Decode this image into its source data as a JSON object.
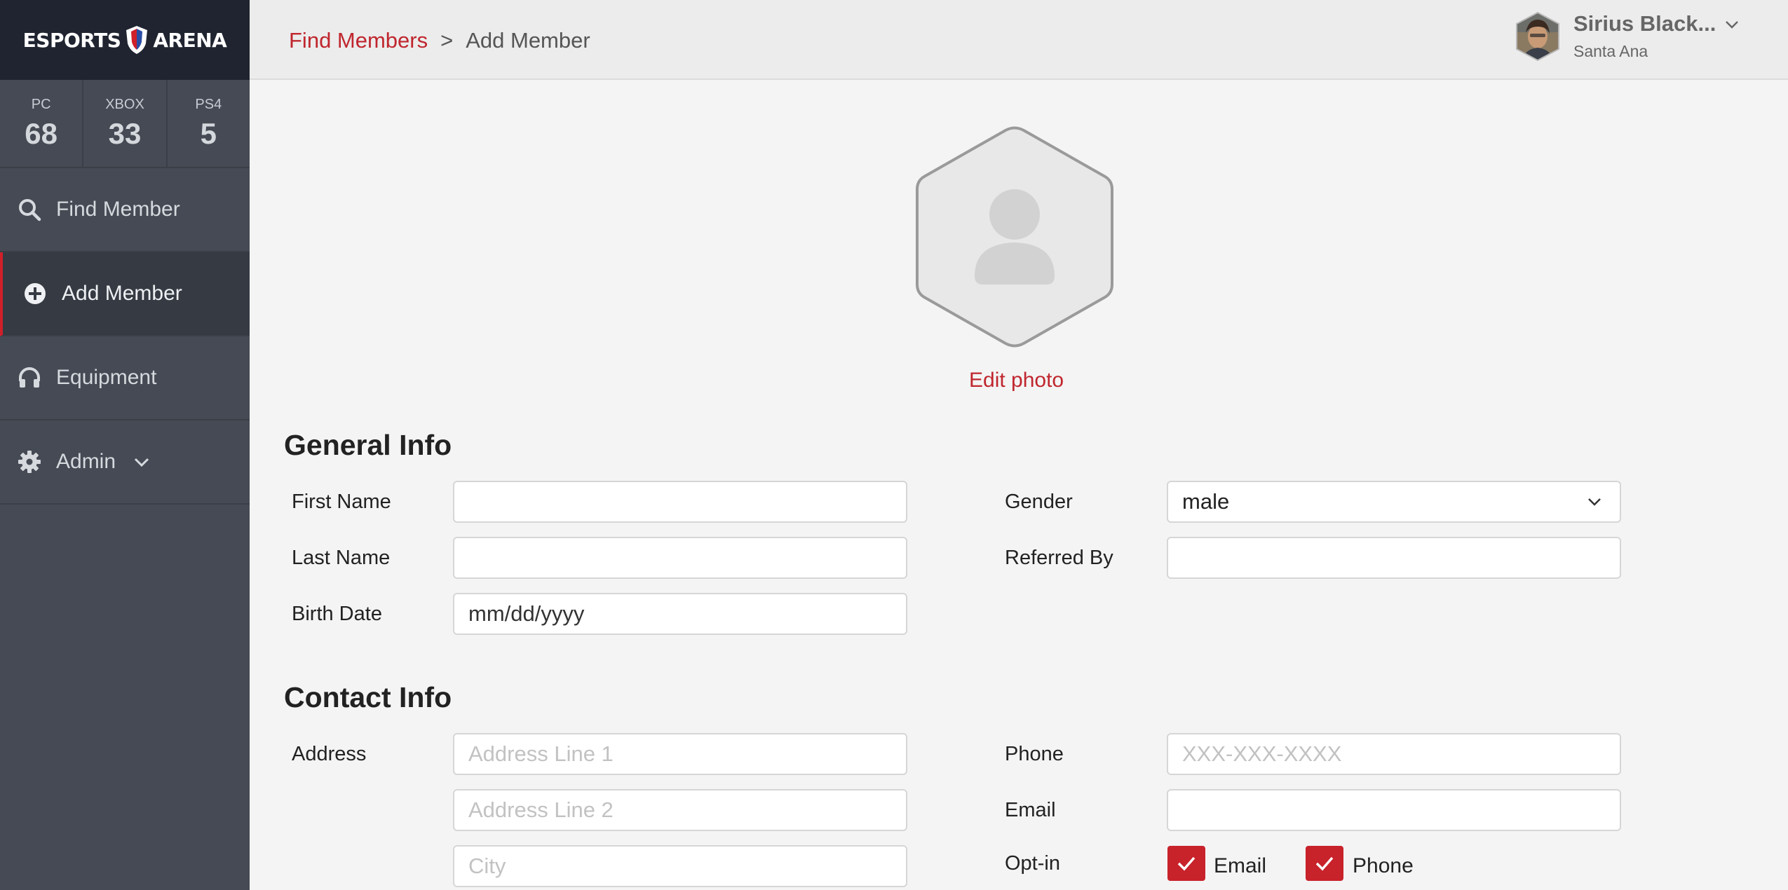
{
  "app": {
    "logo_left": "ESPORTS",
    "logo_right": "ARENA"
  },
  "stats": [
    {
      "label": "PC",
      "value": "68"
    },
    {
      "label": "XBOX",
      "value": "33"
    },
    {
      "label": "PS4",
      "value": "5"
    }
  ],
  "nav": {
    "find_member": "Find Member",
    "add_member": "Add Member",
    "equipment": "Equipment",
    "admin": "Admin"
  },
  "breadcrumb": {
    "link": "Find Members",
    "separator": ">",
    "current": "Add Member"
  },
  "user": {
    "name": "Sirius Black...",
    "location": "Santa Ana"
  },
  "photo": {
    "edit_label": "Edit photo"
  },
  "general": {
    "title": "General Info",
    "first_name_label": "First Name",
    "first_name_value": "",
    "last_name_label": "Last Name",
    "last_name_value": "",
    "birth_date_label": "Birth Date",
    "birth_date_value": "mm/dd/yyyy",
    "gender_label": "Gender",
    "gender_value": "male",
    "referred_by_label": "Referred By",
    "referred_by_value": ""
  },
  "contact": {
    "title": "Contact Info",
    "address_label": "Address",
    "address1_placeholder": "Address Line 1",
    "address2_placeholder": "Address Line 2",
    "city_placeholder": "City",
    "phone_label": "Phone",
    "phone_placeholder": "XXX-XXX-XXXX",
    "email_label": "Email",
    "email_value": "",
    "optin_label": "Opt-in",
    "optin_email": "Email",
    "optin_phone": "Phone"
  },
  "colors": {
    "accent": "#c0262e",
    "sidebar": "#454a54",
    "logo_bar": "#1f2430"
  }
}
